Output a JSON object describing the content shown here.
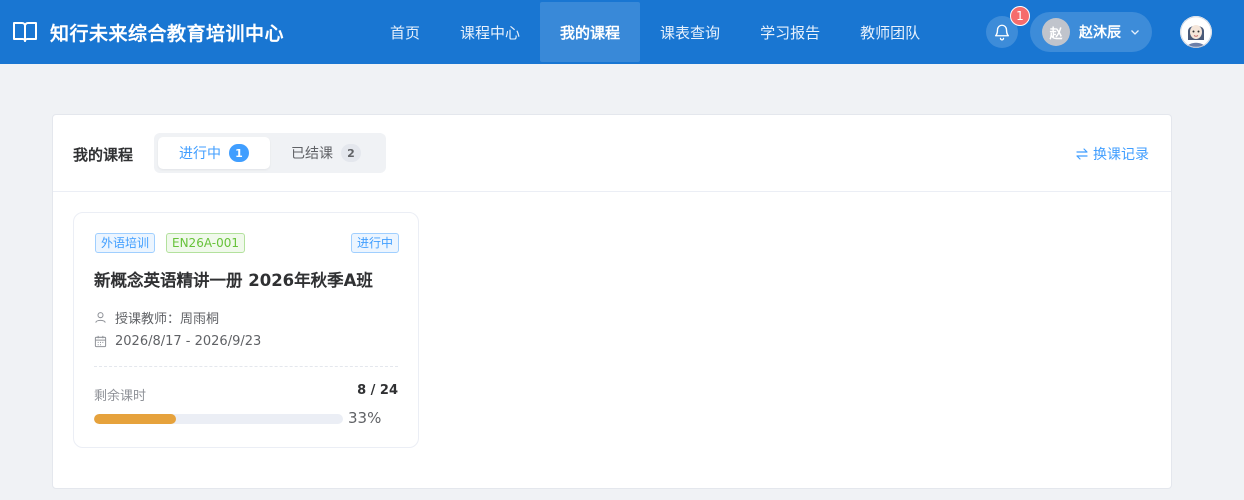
{
  "header": {
    "brand_title": "知行未来综合教育培训中心",
    "nav": [
      {
        "label": "首页",
        "active": false
      },
      {
        "label": "课程中心",
        "active": false
      },
      {
        "label": "我的课程",
        "active": true
      },
      {
        "label": "课表查询",
        "active": false
      },
      {
        "label": "学习报告",
        "active": false
      },
      {
        "label": "教师团队",
        "active": false
      }
    ],
    "notification_count": "1",
    "user": {
      "initial": "赵",
      "name": "赵沐辰"
    },
    "icons": {
      "brand": "book-open-icon",
      "bell": "bell-icon",
      "chevron": "chevron-down-icon",
      "avatar": "user-avatar-icon"
    }
  },
  "page": {
    "title": "我的课程",
    "tabs": [
      {
        "label": "进行中",
        "count": "1",
        "active": true
      },
      {
        "label": "已结课",
        "count": "2",
        "active": false
      }
    ],
    "swap_link": "换课记录"
  },
  "course": {
    "tag_type": "外语培训",
    "tag_code": "EN26A-001",
    "status": "进行中",
    "title": "新概念英语精讲一册 2026年秋季A班",
    "teacher_label": "授课教师：",
    "teacher_name": "周雨桐",
    "date_range": "2026/8/17 - 2026/9/23",
    "remaining_label": "剩余课时",
    "remaining_value": "8 / 24",
    "progress_fraction": 0.33,
    "progress_text": "33%"
  },
  "colors": {
    "header_bg": "#1976d2",
    "primary": "#409eff",
    "success": "#67c23a",
    "warning": "#e6a23c",
    "danger": "#f56c6c"
  }
}
